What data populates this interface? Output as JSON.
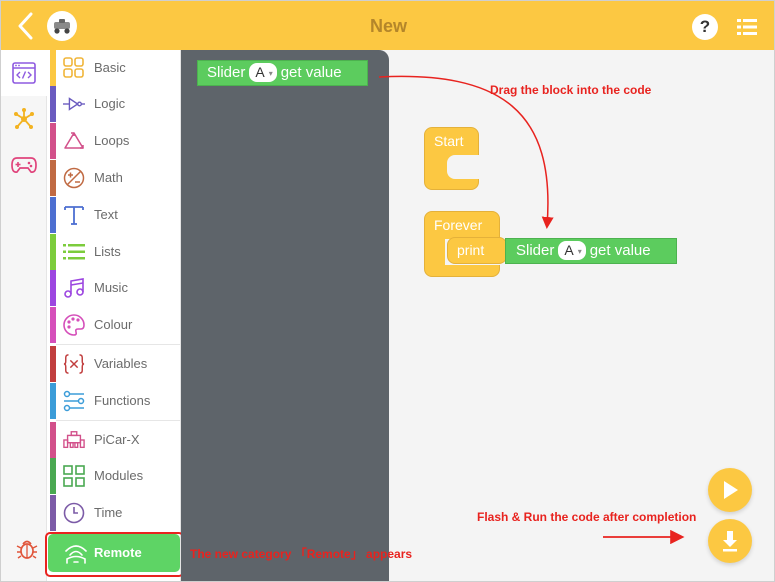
{
  "header": {
    "title": "New",
    "help_label": "?"
  },
  "colors": {
    "accent": "#fcc842",
    "annotation": "#e8231f",
    "flyout": "#5e646a",
    "green_block": "#5ccc5e"
  },
  "rail": {
    "items": [
      {
        "icon": "code-window-icon",
        "active": true
      },
      {
        "icon": "network-nodes-icon",
        "active": false
      },
      {
        "icon": "gamepad-icon",
        "active": false
      }
    ]
  },
  "categories": [
    {
      "label": "Basic",
      "color": "#fcc842",
      "icon": "grid-icon"
    },
    {
      "label": "Logic",
      "color": "#6a5bbf",
      "icon": "logic-gate-icon"
    },
    {
      "label": "Loops",
      "color": "#d2508a",
      "icon": "loop-arrows-icon"
    },
    {
      "label": "Math",
      "color": "#c06a43",
      "icon": "plus-minus-icon"
    },
    {
      "label": "Text",
      "color": "#4d6fd1",
      "icon": "text-t-icon"
    },
    {
      "label": "Lists",
      "color": "#7ccc3c",
      "icon": "list-icon"
    },
    {
      "label": "Music",
      "color": "#9c46e0",
      "icon": "music-note-icon"
    },
    {
      "label": "Colour",
      "color": "#d54fba",
      "icon": "palette-icon"
    },
    {
      "label": "Variables",
      "color": "#c13e3e",
      "icon": "braces-x-icon"
    },
    {
      "label": "Functions",
      "color": "#3b9cd8",
      "icon": "functions-icon"
    },
    {
      "label": "PiCar-X",
      "color": "#d2508a",
      "icon": "car-icon"
    },
    {
      "label": "Modules",
      "color": "#4aa851",
      "icon": "modules-icon"
    },
    {
      "label": "Time",
      "color": "#7c5ba7",
      "icon": "clock-icon"
    }
  ],
  "remote": {
    "label": "Remote",
    "icon": "remote-signal-icon"
  },
  "flyout_block": {
    "prefix": "Slider",
    "dropdown": "A",
    "suffix": "get value"
  },
  "workspace": {
    "start_label": "Start",
    "forever_label": "Forever",
    "print_label": "print",
    "slider_block": {
      "prefix": "Slider",
      "dropdown": "A",
      "suffix": "get value"
    }
  },
  "annotations": {
    "drag": "Drag the block into the code",
    "flash": "Flash & Run the code after completion",
    "new_category": "The new category 「Remote」 appears"
  },
  "fabs": [
    {
      "icon": "play-icon"
    },
    {
      "icon": "download-icon"
    }
  ]
}
